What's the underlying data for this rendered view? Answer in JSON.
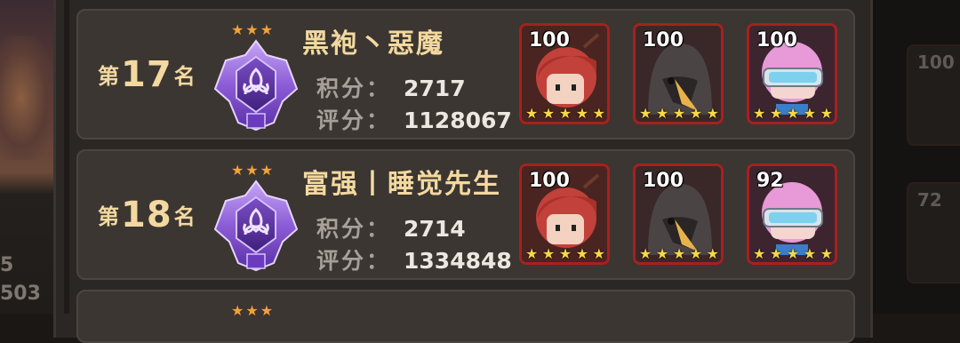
{
  "background": {
    "left_numbers": [
      "5",
      "503"
    ]
  },
  "rows": [
    {
      "rank_prefix": "第",
      "rank": "17",
      "rank_suffix": "名",
      "name": "黑袍丶惡魔",
      "score_label": "积分：",
      "score": "2717",
      "rating_label": "评分：",
      "rating": "1128067",
      "heroes": [
        {
          "level": "100",
          "stars": 5,
          "icon": "red-hair-hero-icon"
        },
        {
          "level": "100",
          "stars": 5,
          "icon": "plague-doctor-hero-icon"
        },
        {
          "level": "100",
          "stars": 5,
          "icon": "visor-hero-icon"
        }
      ]
    },
    {
      "rank_prefix": "第",
      "rank": "18",
      "rank_suffix": "名",
      "name": "富强丨睡觉先生",
      "score_label": "积分：",
      "score": "2714",
      "rating_label": "评分：",
      "rating": "1334848",
      "heroes": [
        {
          "level": "100",
          "stars": 5,
          "icon": "red-hair-hero-icon"
        },
        {
          "level": "100",
          "stars": 5,
          "icon": "plague-doctor-hero-icon"
        },
        {
          "level": "92",
          "stars": 5,
          "icon": "visor-hero-icon"
        }
      ]
    }
  ],
  "right_partial": {
    "levels": [
      "100",
      "72"
    ]
  },
  "colors": {
    "rank_gold": "#f3d9a0",
    "card_border": "#a8201e",
    "emblem_purple": "#8b5cd6",
    "star_orange": "#f3a13a",
    "star_yellow": "#f8d846"
  }
}
